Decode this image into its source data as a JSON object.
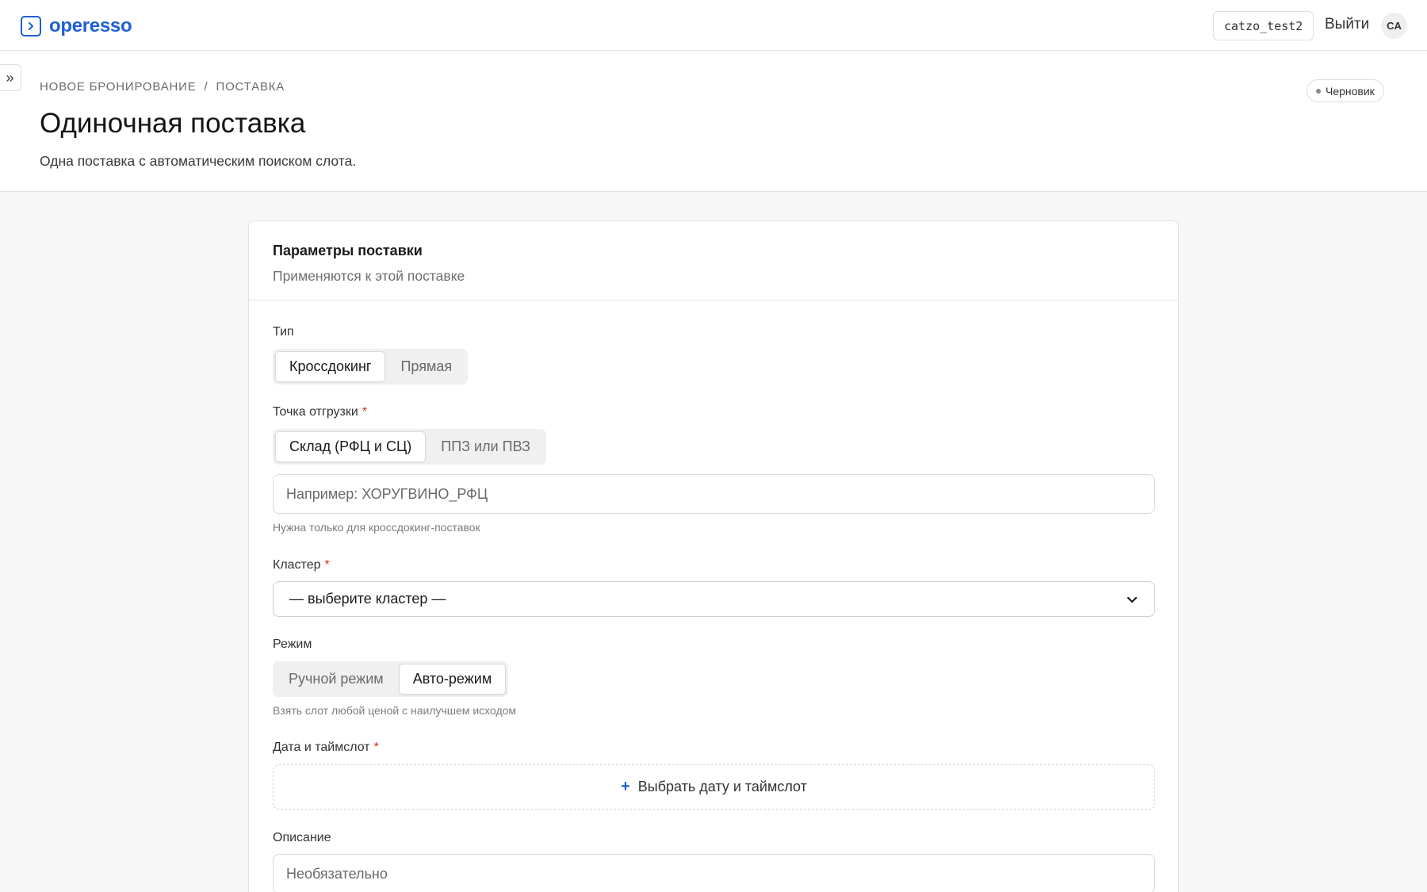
{
  "app": {
    "logo_text": "operesso",
    "logo_icon": "chevron-right-square-icon"
  },
  "topbar": {
    "username": "catzo_test2",
    "logout_label": "Выйти",
    "avatar_initials": "CA"
  },
  "sidebar": {
    "toggle_label": "»"
  },
  "breadcrumb": {
    "items": [
      "НОВОЕ БРОНИРОВАНИЕ",
      "ПОСТАВКА"
    ],
    "separator": "/"
  },
  "page": {
    "title": "Одиночная поставка",
    "subtitle": "Одна поставка с автоматическим поиском слота.",
    "status": "Черновик"
  },
  "card": {
    "title": "Параметры поставки",
    "subtitle": "Применяются к этой поставке"
  },
  "form": {
    "type": {
      "label": "Тип",
      "options": [
        "Кроссдокинг",
        "Прямая"
      ],
      "selected": "Кроссдокинг"
    },
    "shipment_point": {
      "label": "Точка отгрузки",
      "required_mark": "*",
      "options": [
        "Склад (РФЦ и СЦ)",
        "ППЗ или ПВЗ"
      ],
      "selected": "Склад (РФЦ и СЦ)",
      "placeholder": "Например: ХОРУГВИНО_РФЦ",
      "help": "Нужна только для кроссдокинг-поставок"
    },
    "cluster": {
      "label": "Кластер",
      "required_mark": "*",
      "value": "— выберите кластер —"
    },
    "mode": {
      "label": "Режим",
      "options": [
        "Ручной режим",
        "Авто-режим"
      ],
      "selected": "Авто-режим",
      "help": "Взять слот любой ценой с наилучшем исходом"
    },
    "datetime": {
      "label": "Дата и таймслот",
      "required_mark": "*",
      "button_label": "Выбрать дату и таймслот",
      "icon": "plus-icon"
    },
    "description": {
      "label": "Описание",
      "placeholder": "Необязательно"
    }
  },
  "colors": {
    "accent": "#1f5fd6",
    "required": "#d22c2c",
    "background": "#f7f7f7"
  }
}
